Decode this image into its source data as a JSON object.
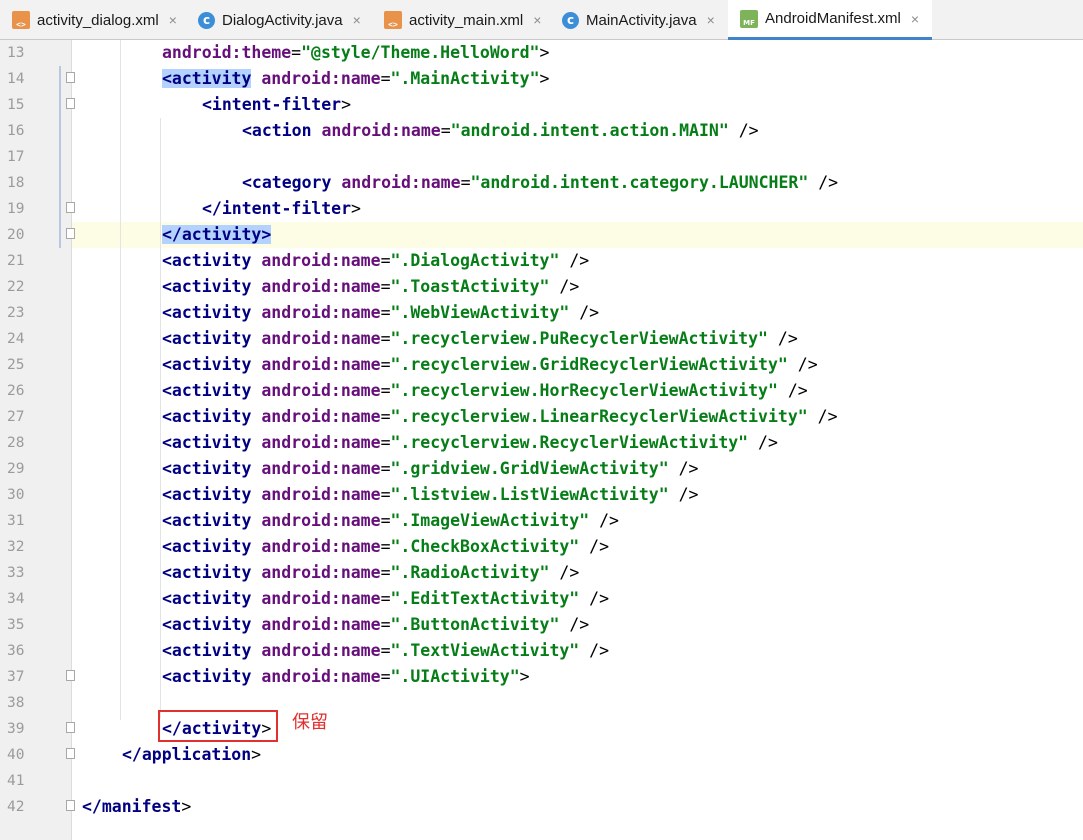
{
  "tabs": [
    {
      "label": "activity_dialog.xml",
      "icon": "xml-file-icon",
      "active": false
    },
    {
      "label": "DialogActivity.java",
      "icon": "java-class-icon",
      "active": false
    },
    {
      "label": "activity_main.xml",
      "icon": "xml-file-icon",
      "active": false
    },
    {
      "label": "MainActivity.java",
      "icon": "java-class-icon",
      "active": false
    },
    {
      "label": "AndroidManifest.xml",
      "icon": "manifest-file-icon",
      "active": true
    }
  ],
  "tab_close_glyph": "×",
  "colors": {
    "tag": "#000080",
    "attribute": "#660e7a",
    "value": "#067d17",
    "annotation": "#e03030",
    "selection": "#b3d2ff",
    "current_line": "#fdfce4",
    "active_tab_underline": "#4083c9"
  },
  "editor": {
    "current_line": 20,
    "lines": [
      {
        "n": "13",
        "indent": 2,
        "parts": [
          {
            "t": "a",
            "s": "android:theme"
          },
          {
            "t": "p",
            "s": "="
          },
          {
            "t": "v",
            "s": "\"@style/Theme.HelloWord\""
          },
          {
            "t": "p",
            "s": ">"
          }
        ]
      },
      {
        "n": "14",
        "indent": 2,
        "parts": [
          {
            "t": "t",
            "s": "<activity",
            "hl": true
          },
          {
            "t": "p",
            "s": " "
          },
          {
            "t": "a",
            "s": "android:name"
          },
          {
            "t": "p",
            "s": "="
          },
          {
            "t": "v",
            "s": "\".MainActivity\""
          },
          {
            "t": "p",
            "s": ">"
          }
        ]
      },
      {
        "n": "15",
        "indent": 3,
        "parts": [
          {
            "t": "t",
            "s": "<intent-filter"
          },
          {
            "t": "p",
            "s": ">"
          }
        ]
      },
      {
        "n": "16",
        "indent": 4,
        "parts": [
          {
            "t": "t",
            "s": "<action"
          },
          {
            "t": "p",
            "s": " "
          },
          {
            "t": "a",
            "s": "android:name"
          },
          {
            "t": "p",
            "s": "="
          },
          {
            "t": "v",
            "s": "\"android.intent.action.MAIN\""
          },
          {
            "t": "p",
            "s": " />"
          }
        ]
      },
      {
        "n": "17",
        "indent": 0,
        "parts": []
      },
      {
        "n": "18",
        "indent": 4,
        "parts": [
          {
            "t": "t",
            "s": "<category"
          },
          {
            "t": "p",
            "s": " "
          },
          {
            "t": "a",
            "s": "android:name"
          },
          {
            "t": "p",
            "s": "="
          },
          {
            "t": "v",
            "s": "\"android.intent.category.LAUNCHER\""
          },
          {
            "t": "p",
            "s": " />"
          }
        ]
      },
      {
        "n": "19",
        "indent": 3,
        "parts": [
          {
            "t": "t",
            "s": "</intent-filter"
          },
          {
            "t": "p",
            "s": ">"
          }
        ]
      },
      {
        "n": "20",
        "indent": 2,
        "parts": [
          {
            "t": "t",
            "s": "</activity>",
            "hl": true
          }
        ]
      },
      {
        "n": "21",
        "indent": 2,
        "parts": [
          {
            "t": "t",
            "s": "<activity"
          },
          {
            "t": "p",
            "s": " "
          },
          {
            "t": "a",
            "s": "android:name"
          },
          {
            "t": "p",
            "s": "="
          },
          {
            "t": "v",
            "s": "\".DialogActivity\""
          },
          {
            "t": "p",
            "s": " />"
          }
        ]
      },
      {
        "n": "22",
        "indent": 2,
        "parts": [
          {
            "t": "t",
            "s": "<activity"
          },
          {
            "t": "p",
            "s": " "
          },
          {
            "t": "a",
            "s": "android:name"
          },
          {
            "t": "p",
            "s": "="
          },
          {
            "t": "v",
            "s": "\".ToastActivity\""
          },
          {
            "t": "p",
            "s": " />"
          }
        ]
      },
      {
        "n": "23",
        "indent": 2,
        "parts": [
          {
            "t": "t",
            "s": "<activity"
          },
          {
            "t": "p",
            "s": " "
          },
          {
            "t": "a",
            "s": "android:name"
          },
          {
            "t": "p",
            "s": "="
          },
          {
            "t": "v",
            "s": "\".WebViewActivity\""
          },
          {
            "t": "p",
            "s": " />"
          }
        ]
      },
      {
        "n": "24",
        "indent": 2,
        "parts": [
          {
            "t": "t",
            "s": "<activity"
          },
          {
            "t": "p",
            "s": " "
          },
          {
            "t": "a",
            "s": "android:name"
          },
          {
            "t": "p",
            "s": "="
          },
          {
            "t": "v",
            "s": "\".recyclerview.PuRecyclerViewActivity\""
          },
          {
            "t": "p",
            "s": " />"
          }
        ]
      },
      {
        "n": "25",
        "indent": 2,
        "parts": [
          {
            "t": "t",
            "s": "<activity"
          },
          {
            "t": "p",
            "s": " "
          },
          {
            "t": "a",
            "s": "android:name"
          },
          {
            "t": "p",
            "s": "="
          },
          {
            "t": "v",
            "s": "\".recyclerview.GridRecyclerViewActivity\""
          },
          {
            "t": "p",
            "s": " />"
          }
        ]
      },
      {
        "n": "26",
        "indent": 2,
        "parts": [
          {
            "t": "t",
            "s": "<activity"
          },
          {
            "t": "p",
            "s": " "
          },
          {
            "t": "a",
            "s": "android:name"
          },
          {
            "t": "p",
            "s": "="
          },
          {
            "t": "v",
            "s": "\".recyclerview.HorRecyclerViewActivity\""
          },
          {
            "t": "p",
            "s": " />"
          }
        ]
      },
      {
        "n": "27",
        "indent": 2,
        "parts": [
          {
            "t": "t",
            "s": "<activity"
          },
          {
            "t": "p",
            "s": " "
          },
          {
            "t": "a",
            "s": "android:name"
          },
          {
            "t": "p",
            "s": "="
          },
          {
            "t": "v",
            "s": "\".recyclerview.LinearRecyclerViewActivity\""
          },
          {
            "t": "p",
            "s": " />"
          }
        ]
      },
      {
        "n": "28",
        "indent": 2,
        "parts": [
          {
            "t": "t",
            "s": "<activity"
          },
          {
            "t": "p",
            "s": " "
          },
          {
            "t": "a",
            "s": "android:name"
          },
          {
            "t": "p",
            "s": "="
          },
          {
            "t": "v",
            "s": "\".recyclerview.RecyclerViewActivity\""
          },
          {
            "t": "p",
            "s": " />"
          }
        ]
      },
      {
        "n": "29",
        "indent": 2,
        "parts": [
          {
            "t": "t",
            "s": "<activity"
          },
          {
            "t": "p",
            "s": " "
          },
          {
            "t": "a",
            "s": "android:name"
          },
          {
            "t": "p",
            "s": "="
          },
          {
            "t": "v",
            "s": "\".gridview.GridViewActivity\""
          },
          {
            "t": "p",
            "s": " />"
          }
        ]
      },
      {
        "n": "30",
        "indent": 2,
        "parts": [
          {
            "t": "t",
            "s": "<activity"
          },
          {
            "t": "p",
            "s": " "
          },
          {
            "t": "a",
            "s": "android:name"
          },
          {
            "t": "p",
            "s": "="
          },
          {
            "t": "v",
            "s": "\".listview.ListViewActivity\""
          },
          {
            "t": "p",
            "s": " />"
          }
        ]
      },
      {
        "n": "31",
        "indent": 2,
        "parts": [
          {
            "t": "t",
            "s": "<activity"
          },
          {
            "t": "p",
            "s": " "
          },
          {
            "t": "a",
            "s": "android:name"
          },
          {
            "t": "p",
            "s": "="
          },
          {
            "t": "v",
            "s": "\".ImageViewActivity\""
          },
          {
            "t": "p",
            "s": " />"
          }
        ]
      },
      {
        "n": "32",
        "indent": 2,
        "parts": [
          {
            "t": "t",
            "s": "<activity"
          },
          {
            "t": "p",
            "s": " "
          },
          {
            "t": "a",
            "s": "android:name"
          },
          {
            "t": "p",
            "s": "="
          },
          {
            "t": "v",
            "s": "\".CheckBoxActivity\""
          },
          {
            "t": "p",
            "s": " />"
          }
        ]
      },
      {
        "n": "33",
        "indent": 2,
        "parts": [
          {
            "t": "t",
            "s": "<activity"
          },
          {
            "t": "p",
            "s": " "
          },
          {
            "t": "a",
            "s": "android:name"
          },
          {
            "t": "p",
            "s": "="
          },
          {
            "t": "v",
            "s": "\".RadioActivity\""
          },
          {
            "t": "p",
            "s": " />"
          }
        ]
      },
      {
        "n": "34",
        "indent": 2,
        "parts": [
          {
            "t": "t",
            "s": "<activity"
          },
          {
            "t": "p",
            "s": " "
          },
          {
            "t": "a",
            "s": "android:name"
          },
          {
            "t": "p",
            "s": "="
          },
          {
            "t": "v",
            "s": "\".EditTextActivity\""
          },
          {
            "t": "p",
            "s": " />"
          }
        ]
      },
      {
        "n": "35",
        "indent": 2,
        "parts": [
          {
            "t": "t",
            "s": "<activity"
          },
          {
            "t": "p",
            "s": " "
          },
          {
            "t": "a",
            "s": "android:name"
          },
          {
            "t": "p",
            "s": "="
          },
          {
            "t": "v",
            "s": "\".ButtonActivity\""
          },
          {
            "t": "p",
            "s": " />"
          }
        ]
      },
      {
        "n": "36",
        "indent": 2,
        "parts": [
          {
            "t": "t",
            "s": "<activity"
          },
          {
            "t": "p",
            "s": " "
          },
          {
            "t": "a",
            "s": "android:name"
          },
          {
            "t": "p",
            "s": "="
          },
          {
            "t": "v",
            "s": "\".TextViewActivity\""
          },
          {
            "t": "p",
            "s": " />"
          }
        ]
      },
      {
        "n": "37",
        "indent": 2,
        "parts": [
          {
            "t": "t",
            "s": "<activity"
          },
          {
            "t": "p",
            "s": " "
          },
          {
            "t": "a",
            "s": "android:name"
          },
          {
            "t": "p",
            "s": "="
          },
          {
            "t": "v",
            "s": "\".UIActivity\""
          },
          {
            "t": "p",
            "s": ">"
          }
        ]
      },
      {
        "n": "38",
        "indent": 0,
        "parts": []
      },
      {
        "n": "39",
        "indent": 2,
        "parts": [
          {
            "t": "t",
            "s": "</activity"
          },
          {
            "t": "p",
            "s": ">"
          }
        ]
      },
      {
        "n": "40",
        "indent": 1,
        "parts": [
          {
            "t": "t",
            "s": "</application"
          },
          {
            "t": "p",
            "s": ">"
          }
        ]
      },
      {
        "n": "41",
        "indent": 0,
        "parts": []
      },
      {
        "n": "42",
        "indent": 0,
        "parts": [
          {
            "t": "t",
            "s": "</manifest"
          },
          {
            "t": "p",
            "s": ">"
          }
        ]
      }
    ]
  },
  "annotation": {
    "text": "保留",
    "target_line": 39
  }
}
